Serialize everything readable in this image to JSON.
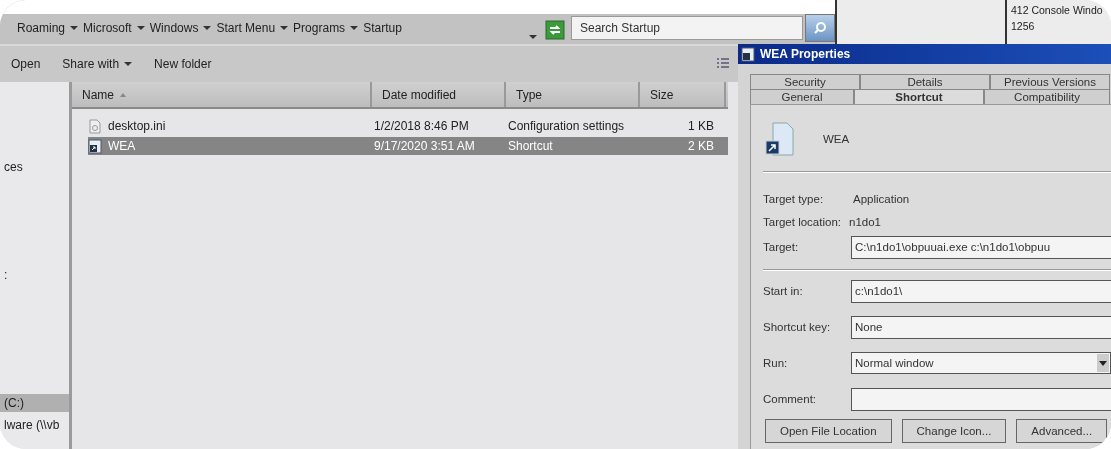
{
  "address_bar": {
    "crumbs": [
      "Roaming",
      "Microsoft",
      "Windows",
      "Start Menu",
      "Programs",
      "Startup"
    ]
  },
  "search": {
    "placeholder": "Search Startup"
  },
  "background_window": {
    "lines": [
      "412 Console Windo",
      "1256"
    ]
  },
  "toolbar": {
    "items": [
      {
        "label": "Open",
        "dropdown": false
      },
      {
        "label": "Share with",
        "dropdown": true
      },
      {
        "label": "New folder",
        "dropdown": false
      }
    ]
  },
  "nav_pane": {
    "items": [
      {
        "label": "ces",
        "selected": false
      },
      {
        "label": ":",
        "selected": false
      },
      {
        "label": "(C:)",
        "selected": true
      },
      {
        "label": "lware (\\\\vb",
        "selected": false
      }
    ]
  },
  "file_list": {
    "columns": [
      "Name",
      "Date modified",
      "Type",
      "Size"
    ],
    "rows": [
      {
        "kind": "settings",
        "name": "desktop.ini",
        "date": "1/2/2018 8:46 PM",
        "type": "Configuration settings",
        "size": "1 KB",
        "selected": false
      },
      {
        "kind": "shortcut",
        "name": "WEA",
        "date": "9/17/2020 3:51 AM",
        "type": "Shortcut",
        "size": "2 KB",
        "selected": true
      }
    ]
  },
  "dialog": {
    "title": "WEA Properties",
    "tab_rows": [
      [
        {
          "label": "Security",
          "selected": false
        },
        {
          "label": "Details",
          "selected": false
        },
        {
          "label": "Previous Versions",
          "selected": false
        }
      ],
      [
        {
          "label": "General",
          "selected": false
        },
        {
          "label": "Shortcut",
          "selected": true
        },
        {
          "label": "Compatibility",
          "selected": false
        }
      ]
    ],
    "file_name": "WEA",
    "info": [
      {
        "label": "Target type:",
        "value": "Application"
      },
      {
        "label": "Target location:",
        "value": "n1do1"
      }
    ],
    "target": {
      "label": "Target:",
      "value": "C:\\n1do1\\obpuuai.exe c:\\n1do1\\obpuu"
    },
    "fields": [
      {
        "kind": "text",
        "label": "Start in:",
        "value": "c:\\n1do1\\"
      },
      {
        "kind": "text",
        "label": "Shortcut key:",
        "value": "None"
      },
      {
        "kind": "select",
        "label": "Run:",
        "value": "Normal window"
      },
      {
        "kind": "text",
        "label": "Comment:"
      }
    ],
    "buttons": [
      "Open File Location",
      "Change Icon...",
      "Advanced..."
    ]
  }
}
